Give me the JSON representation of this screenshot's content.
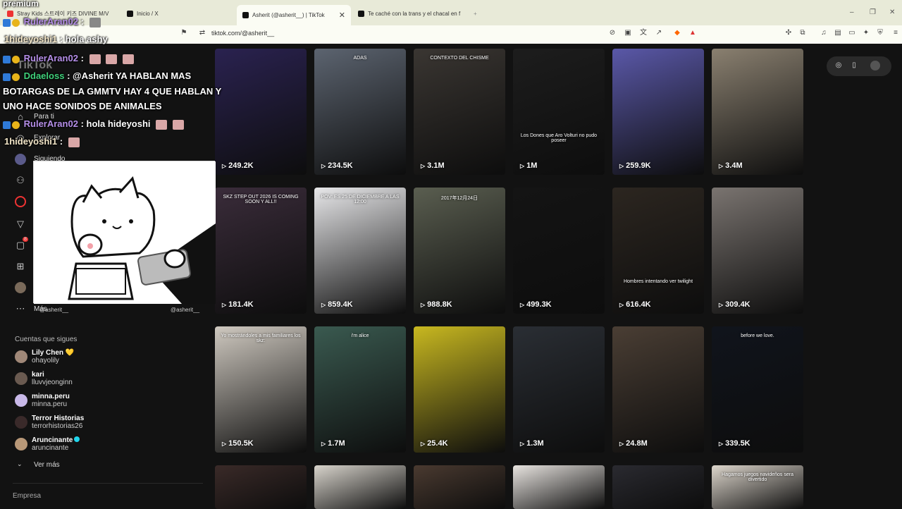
{
  "browser": {
    "tabs": [
      {
        "title": "Stray Kids 스트레이 키즈 DIVINE M/V"
      },
      {
        "title": "Inicio / X"
      },
      {
        "title": "Asherit (@asherit__) | TikTok",
        "active": true
      },
      {
        "title": "Te caché con la trans y el chacal en f"
      }
    ],
    "url": "tiktok.com/@asherit__",
    "window_controls": [
      "–",
      "❐",
      "✕"
    ]
  },
  "sidebar": {
    "brand": "TikTok",
    "nav": [
      {
        "label": "Para ti",
        "icon": "home-icon"
      },
      {
        "label": "Explorar",
        "icon": "compass-icon"
      },
      {
        "label": "Siguiendo",
        "icon": "following-icon"
      },
      {
        "label": "",
        "icon": "friends-icon"
      },
      {
        "label": "",
        "icon": "live-icon"
      },
      {
        "label": "",
        "icon": "send-icon"
      },
      {
        "label": "",
        "icon": "messages-icon",
        "badge": "8"
      },
      {
        "label": "",
        "icon": "upload-icon"
      },
      {
        "label": "",
        "icon": "profile-avatar"
      },
      {
        "label": "Más",
        "icon": "more-icon"
      }
    ],
    "following_title": "Cuentas que sigues",
    "following": [
      {
        "name": "Lily Chen 💛",
        "user": "ohayolily"
      },
      {
        "name": "kari",
        "user": "lluvvjeonginn"
      },
      {
        "name": "minna.peru",
        "user": "minna.peru"
      },
      {
        "name": "Terror Historias",
        "user": "terrorhistorias26"
      },
      {
        "name": "Aruncinante",
        "user": "aruncinante",
        "verified": true
      }
    ],
    "see_more": "Ver más",
    "company": "Empresa"
  },
  "videos": [
    {
      "views": "249.2K",
      "color": "#2a2250",
      "caption": ""
    },
    {
      "views": "234.5K",
      "color": "#5c6470",
      "caption": "ADAS"
    },
    {
      "views": "3.1M",
      "color": "#3a3632",
      "caption": "CONTEXTO DEL CHISME"
    },
    {
      "views": "1M",
      "color": "#1d1d1d",
      "caption": "Los Dones que Aro Volturi no pudo poseer"
    },
    {
      "views": "259.9K",
      "color": "#5a58a8",
      "caption": ""
    },
    {
      "views": "3.4M",
      "color": "#8a8070",
      "caption": ""
    },
    {
      "views": "181.4K",
      "color": "#3a2c3a",
      "caption": "SKZ STEP OUT 2026 IS COMING SOON Y ALL!!"
    },
    {
      "views": "859.4K",
      "color": "#e8e8ea",
      "caption": "POV: ES 25 DE DICIEMBRE A LAS 12:00"
    },
    {
      "views": "988.8K",
      "color": "#5a5e50",
      "caption": "2017年12月24日"
    },
    {
      "views": "499.3K",
      "color": "#141414",
      "caption": ""
    },
    {
      "views": "616.4K",
      "color": "#2c2620",
      "caption": "Hombres intentando ver twilight"
    },
    {
      "views": "309.4K",
      "color": "#7a7470",
      "caption": ""
    },
    {
      "views": "150.5K",
      "color": "#cfc9c0",
      "caption": "Yo mostrándoles a mis familiares los skz:"
    },
    {
      "views": "1.7M",
      "color": "#3a5a50",
      "caption": "i'm alice"
    },
    {
      "views": "25.4K",
      "color": "#c8b820",
      "caption": ""
    },
    {
      "views": "1.3M",
      "color": "#2a2e34",
      "caption": ""
    },
    {
      "views": "24.8M",
      "color": "#4a3e34",
      "caption": ""
    },
    {
      "views": "339.5K",
      "color": "#10141c",
      "caption": "before we love."
    },
    {
      "views": "",
      "color": "#3a2a28",
      "caption": ""
    },
    {
      "views": "",
      "color": "#d8d4cc",
      "caption": ""
    },
    {
      "views": "",
      "color": "#4a3a30",
      "caption": ""
    },
    {
      "views": "",
      "color": "#e8e4e0",
      "caption": ""
    },
    {
      "views": "",
      "color": "#2a2a30",
      "caption": ""
    },
    {
      "views": "",
      "color": "#ddd6cc",
      "caption": "Hagamos juegos navideños sera divertido"
    }
  ],
  "chat": {
    "top_label": "premium",
    "messages": [
      {
        "user": "RulerAran02",
        "text": ":",
        "color": "purple",
        "badges": true
      },
      {
        "user": "1hideyoshi1",
        "text": ": hola ashy",
        "color": "white",
        "badges": false
      },
      {
        "user": "RulerAran02",
        "text": ":",
        "color": "purple",
        "badges": true
      },
      {
        "user": "Ddaeloss",
        "text": ": @Asherit YA HABLAN MAS",
        "color": "green",
        "badges": true
      },
      {
        "user": "",
        "text": "BOTARGAS DE LA GMMTV HAY 4 QUE HABLAN Y",
        "color": "white",
        "badges": false
      },
      {
        "user": "",
        "text": "UNO HACE SONIDOS DE ANIMALES",
        "color": "white",
        "badges": false
      },
      {
        "user": "RulerAran02",
        "text": ": hola hideyoshi",
        "color": "purple",
        "badges": true
      },
      {
        "user": "1hideyoshi1",
        "text": ":",
        "color": "white",
        "badges": false
      }
    ],
    "overlay_handle_left": "@asherit__",
    "overlay_handle_right": "@asherit__"
  }
}
